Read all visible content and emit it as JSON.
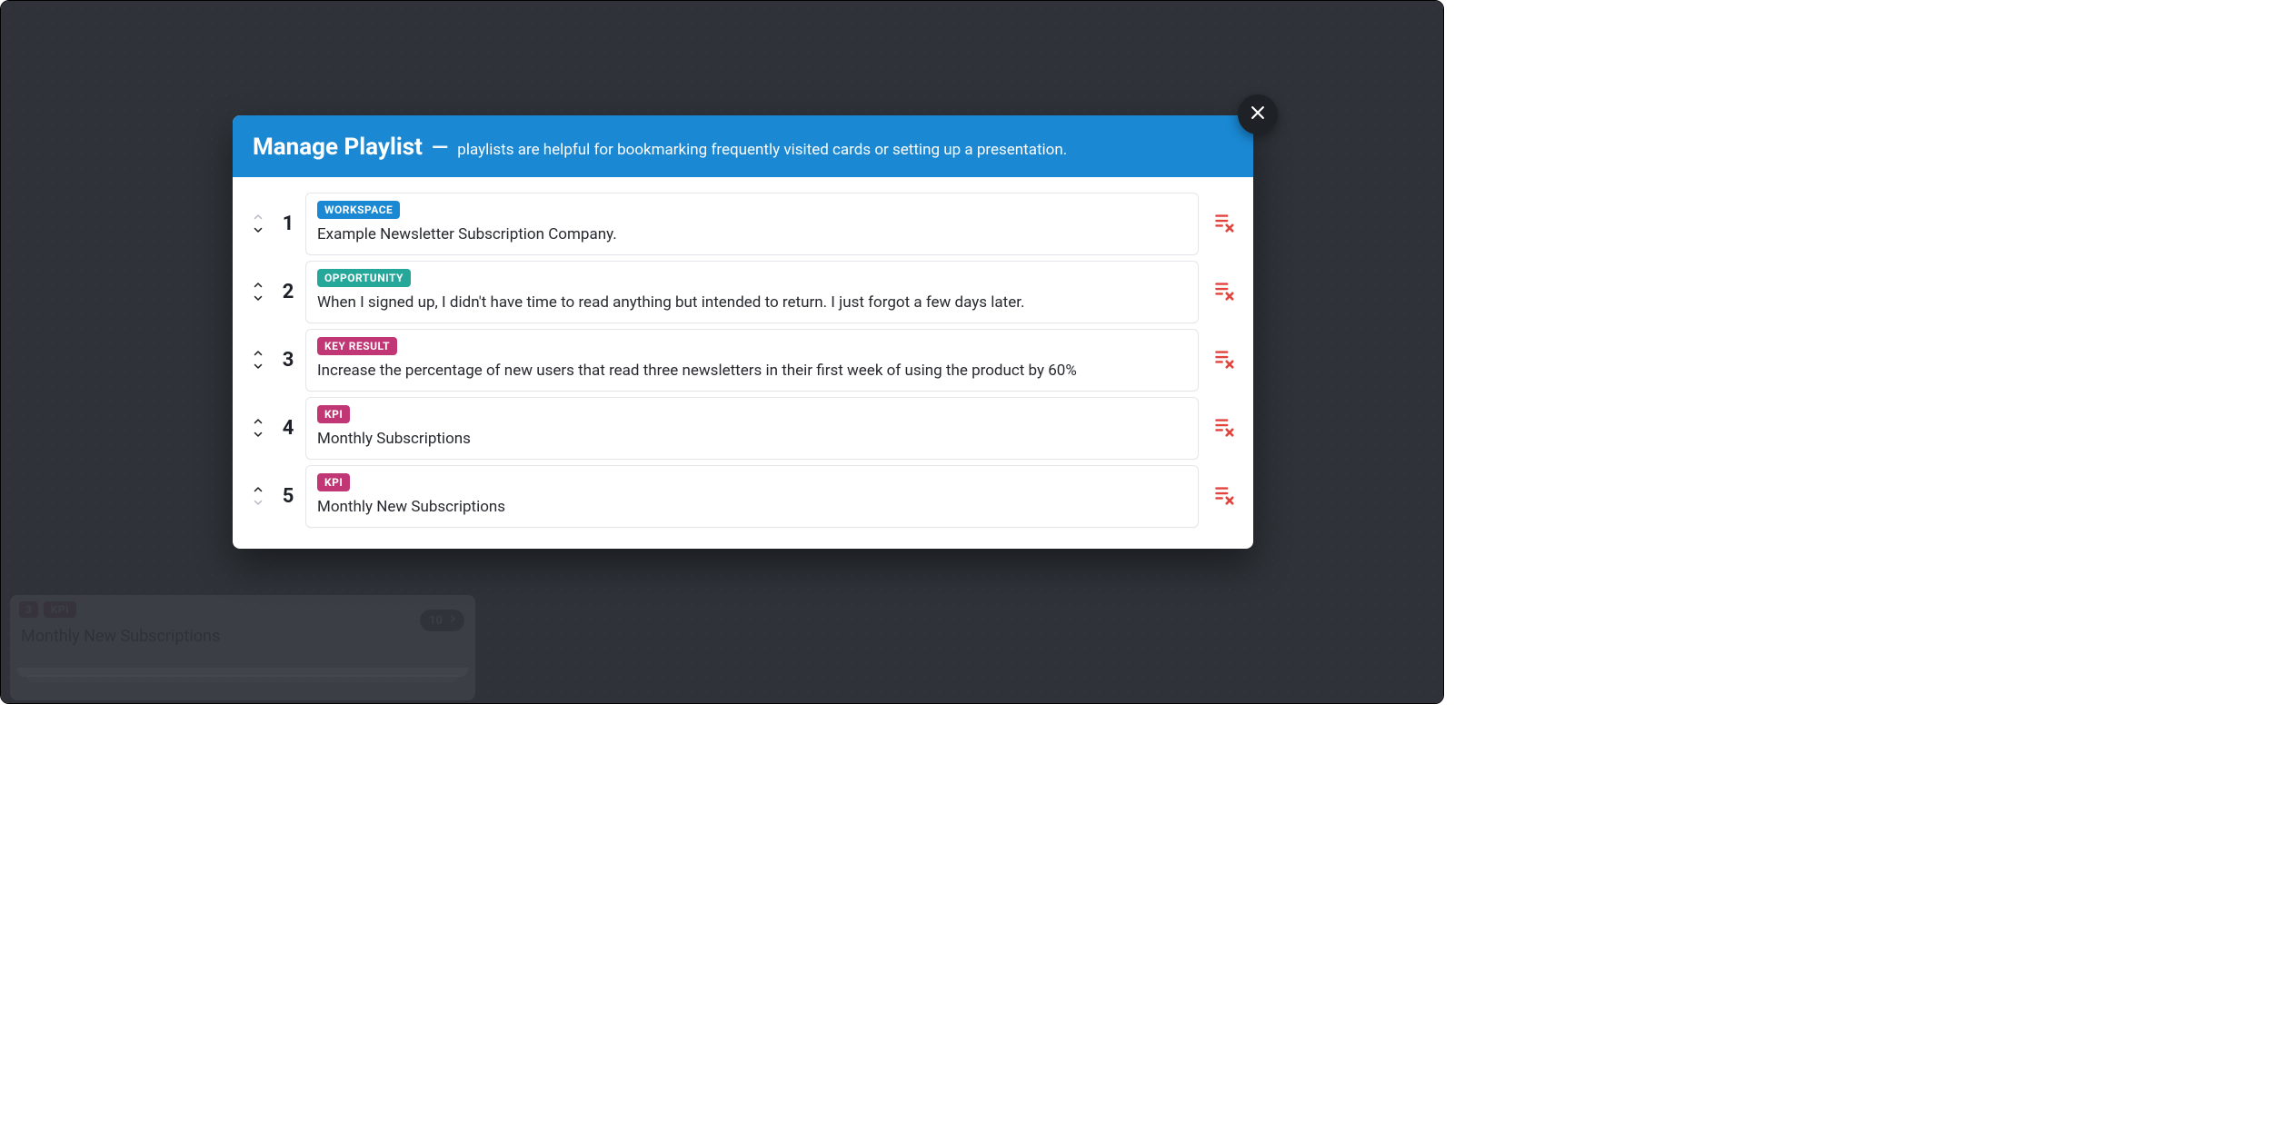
{
  "modal": {
    "title": "Manage Playlist",
    "dash": "—",
    "subtitle": "playlists are helpful for bookmarking frequently visited cards or setting up a presentation."
  },
  "items": [
    {
      "ordinal": "1",
      "badge": "WORKSPACE",
      "badgeClass": "workspace",
      "text": "Example Newsletter Subscription Company.",
      "upDisabled": true,
      "downDisabled": false
    },
    {
      "ordinal": "2",
      "badge": "OPPORTUNITY",
      "badgeClass": "opportunity",
      "text": "When I signed up, I didn't have time to read anything but intended to return. I just forgot a few days later.",
      "upDisabled": false,
      "downDisabled": false
    },
    {
      "ordinal": "3",
      "badge": "KEY RESULT",
      "badgeClass": "keyresult",
      "text": "Increase the percentage of new users that read three newsletters in their first week of using the product by 60%",
      "upDisabled": false,
      "downDisabled": false
    },
    {
      "ordinal": "4",
      "badge": "KPI",
      "badgeClass": "kpi",
      "text": "Monthly Subscriptions",
      "upDisabled": false,
      "downDisabled": false
    },
    {
      "ordinal": "5",
      "badge": "KPI",
      "badgeClass": "kpi",
      "text": "Monthly New Subscriptions",
      "upDisabled": false,
      "downDisabled": true
    }
  ],
  "background_card": {
    "ordinal": "3",
    "badge": "KPI",
    "title": "Monthly New Subscriptions",
    "count": "10"
  }
}
